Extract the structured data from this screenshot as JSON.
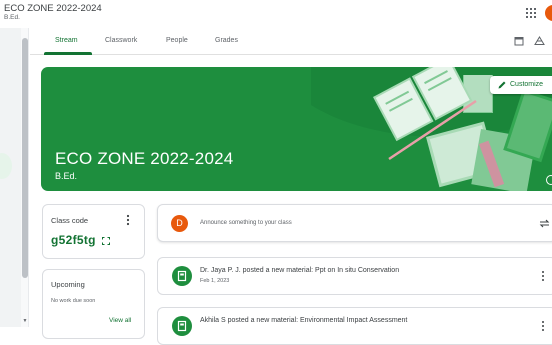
{
  "header": {
    "class_title": "ECO ZONE 2022-2024",
    "class_subtitle": "B.Ed."
  },
  "tabs": [
    {
      "label": "Stream",
      "active": true
    },
    {
      "label": "Classwork",
      "active": false
    },
    {
      "label": "People",
      "active": false
    },
    {
      "label": "Grades",
      "active": false
    }
  ],
  "banner": {
    "title": "ECO ZONE 2022-2024",
    "subtitle": "B.Ed.",
    "customize_label": "Customize"
  },
  "class_code": {
    "label": "Class code",
    "value": "g52f5tg"
  },
  "upcoming": {
    "title": "Upcoming",
    "empty_text": "No work due soon",
    "view_all": "View all"
  },
  "announce": {
    "avatar_letter": "D",
    "placeholder": "Announce something to your class"
  },
  "posts": [
    {
      "title": "Dr. Jaya P. J. posted a new material: Ppt on In situ Conservation",
      "date": "Feb 1, 2023"
    },
    {
      "title": "Akhila S posted a new material: Environmental Impact Assessment",
      "date": ""
    }
  ],
  "colors": {
    "accent_green": "#137333",
    "banner_green": "#1e8e3e",
    "avatar_orange": "#e8590c"
  },
  "icons": [
    "apps-grid-icon",
    "calendar-icon",
    "drive-folder-icon",
    "pencil-icon",
    "more-vert-icon",
    "fullscreen-icon",
    "repost-icon",
    "material-icon",
    "info-icon"
  ]
}
